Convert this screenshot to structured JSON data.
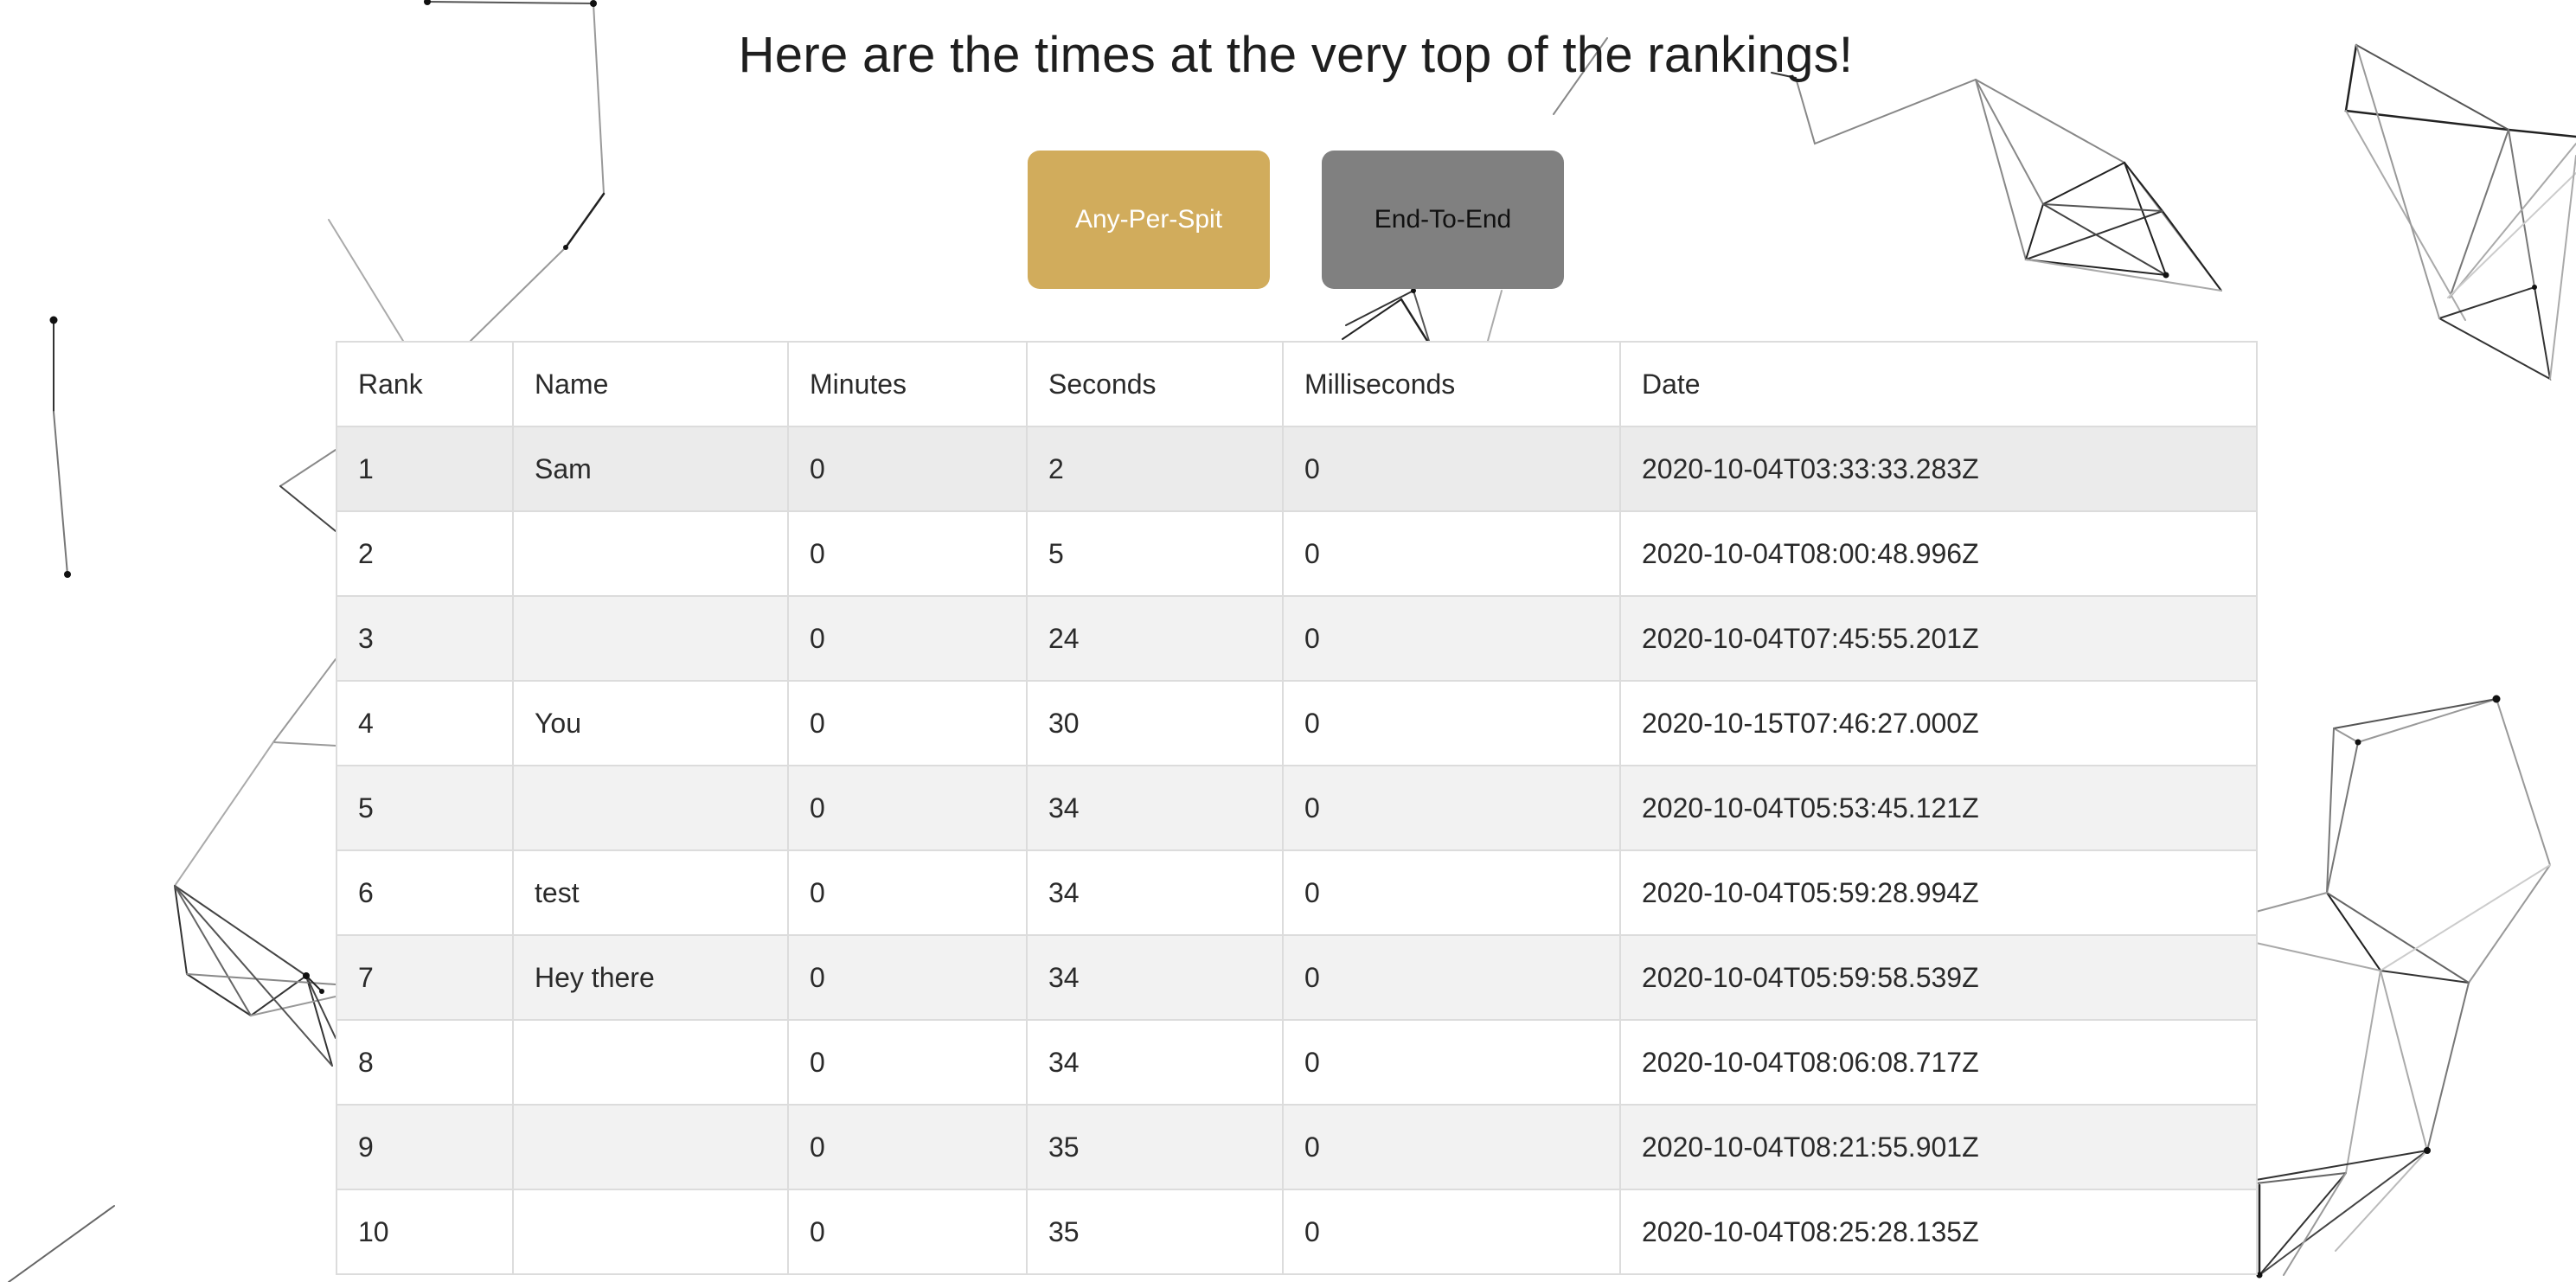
{
  "page": {
    "title": "Here are the times at the very top of the rankings!"
  },
  "buttons": {
    "any_per_spit": "Any-Per-Spit",
    "end_to_end": "End-To-End",
    "any_per_spit_color": "#d1ac5c",
    "end_to_end_color": "#808080"
  },
  "table": {
    "headers": [
      "Rank",
      "Name",
      "Minutes",
      "Seconds",
      "Milliseconds",
      "Date"
    ],
    "rows": [
      [
        "1",
        "Sam",
        "0",
        "2",
        "0",
        "2020-10-04T03:33:33.283Z"
      ],
      [
        "2",
        "",
        "0",
        "5",
        "0",
        "2020-10-04T08:00:48.996Z"
      ],
      [
        "3",
        "",
        "0",
        "24",
        "0",
        "2020-10-04T07:45:55.201Z"
      ],
      [
        "4",
        "You",
        "0",
        "30",
        "0",
        "2020-10-15T07:46:27.000Z"
      ],
      [
        "5",
        "",
        "0",
        "34",
        "0",
        "2020-10-04T05:53:45.121Z"
      ],
      [
        "6",
        "test",
        "0",
        "34",
        "0",
        "2020-10-04T05:59:28.994Z"
      ],
      [
        "7",
        "Hey there",
        "0",
        "34",
        "0",
        "2020-10-04T05:59:58.539Z"
      ],
      [
        "8",
        "",
        "0",
        "34",
        "0",
        "2020-10-04T08:06:08.717Z"
      ],
      [
        "9",
        "",
        "0",
        "35",
        "0",
        "2020-10-04T08:21:55.901Z"
      ],
      [
        "10",
        "",
        "0",
        "35",
        "0",
        "2020-10-04T08:25:28.135Z"
      ]
    ]
  }
}
